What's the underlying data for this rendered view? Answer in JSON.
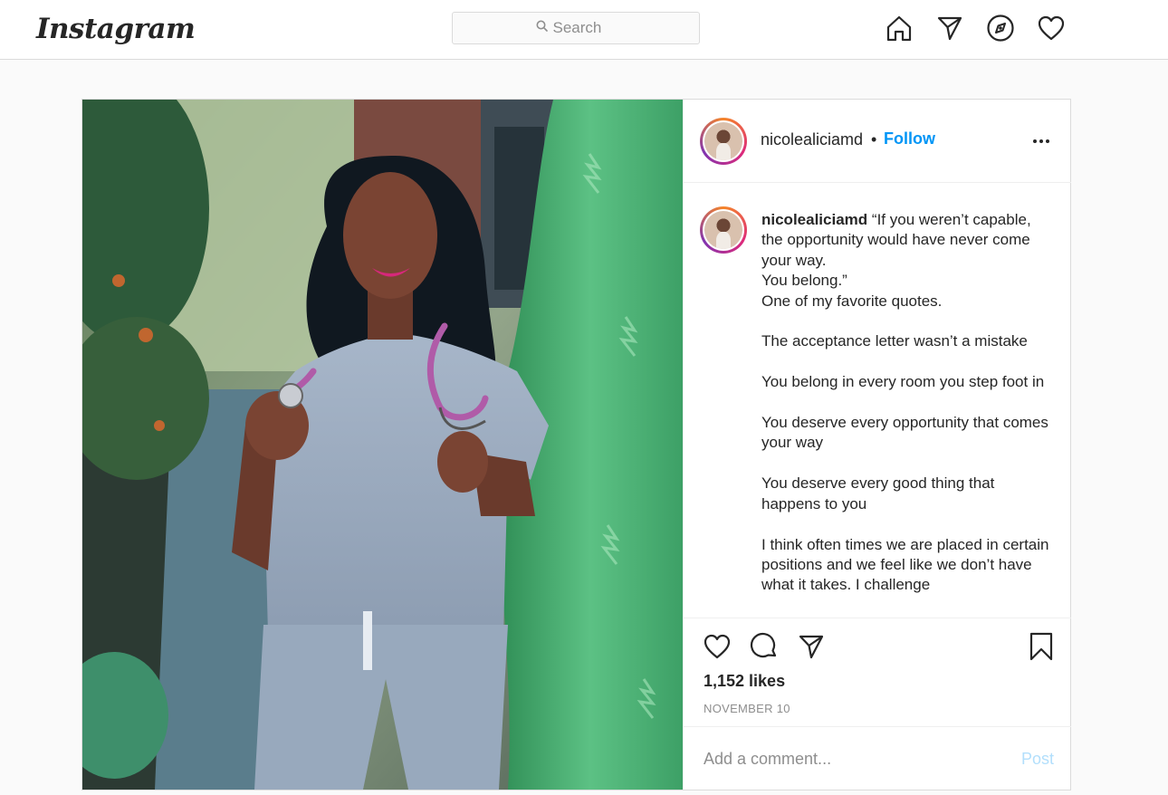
{
  "nav": {
    "logo": "Instagram",
    "search_placeholder": "Search",
    "icons": [
      "home-icon",
      "direct-icon",
      "explore-icon",
      "activity-icon"
    ]
  },
  "post": {
    "username": "nicolealiciamd",
    "follow_label": "Follow",
    "separator": "•",
    "caption": "“If you weren’t capable, the opportunity would have never come your way.\nYou belong.”\nOne of my favorite quotes.\n\nThe acceptance letter wasn’t a mistake\n\nYou belong in every room you step foot in\n\nYou deserve every opportunity that comes your way\n\nYou deserve every good thing that happens to you\n\nI think often times we are placed in certain positions and we feel like we don’t have what it takes. I challenge",
    "likes": "1,152 likes",
    "date": "NOVEMBER 10",
    "comment_placeholder": "Add a comment...",
    "post_label": "Post",
    "action_icons": [
      "like-icon",
      "comment-icon",
      "share-icon",
      "save-icon"
    ]
  },
  "colors": {
    "accent": "#0095f6",
    "post_disabled": "#b2dffc",
    "border": "#dbdbdb",
    "background": "#fafafa"
  }
}
